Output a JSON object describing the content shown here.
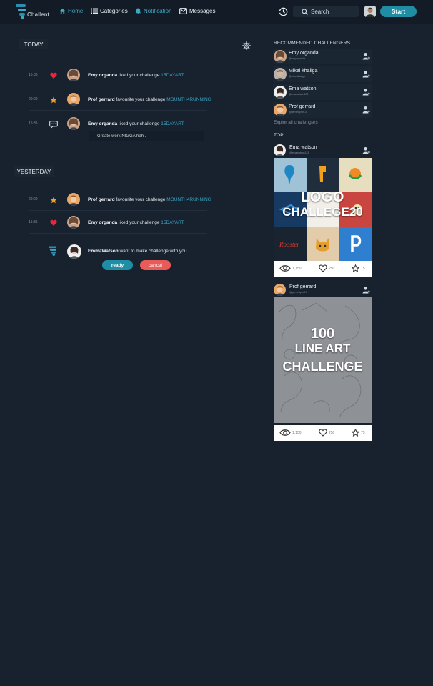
{
  "nav": {
    "brand": "Challent",
    "items": [
      {
        "label": "Home",
        "active": true
      },
      {
        "label": "Categories",
        "active": false
      },
      {
        "label": "Notification",
        "active": true
      },
      {
        "label": "Messages",
        "active": false
      }
    ],
    "search_placeholder": "Search",
    "start_label": "Start"
  },
  "colors": {
    "accent": "#1f8ea4",
    "danger": "#e85b58",
    "background": "#18222f",
    "heart": "#e8283a",
    "star": "#f0a21d"
  },
  "notifications": {
    "today_label": "TODAY",
    "yesterday_label": "YESTERDAY",
    "today": [
      {
        "time": "15:35",
        "icon": "heart-icon",
        "user": "Emy organda",
        "action": "liked your challenge",
        "tag": "15DAYART"
      },
      {
        "time": "20:00",
        "icon": "star-icon",
        "user": "Prof gerrard",
        "action": "favourite your challenge",
        "tag": "MOUNTH4RUNNING"
      },
      {
        "time": "15:35",
        "icon": "comment-icon",
        "user": "Emy organda",
        "action": "liked your challenge",
        "tag": "15DAYART"
      }
    ],
    "comment": "Greate work NIGGA hah .",
    "yesterday": [
      {
        "time": "20:00",
        "icon": "star-icon",
        "user": "Prof gerrard",
        "action": "favourite your challenge",
        "tag": "MOUNTH4RUNNING"
      },
      {
        "time": "15:35",
        "icon": "heart-icon",
        "user": "Emy organda",
        "action": "liked your challenge",
        "tag": "15DAYART"
      }
    ],
    "request": {
      "user": "EmmaWatson",
      "text": "want to make challenge with you",
      "ready_label": "ready",
      "cancel_label": "cancel"
    }
  },
  "sidebar": {
    "recommended_title": "RECOMMENDED CHALLENGERS",
    "recommended": [
      {
        "name": "Emy organda",
        "handle": "@emyorganda"
      },
      {
        "name": "Mikel khallga",
        "handle": "@mikelkhallga"
      },
      {
        "name": "Ema watson",
        "handle": "@emawatson123"
      },
      {
        "name": "Prof gerrard",
        "handle": "@gerrardprof13"
      }
    ],
    "explore_label": "Explor all challengers",
    "top_title": "TOP",
    "cards": [
      {
        "name": "Ema watson",
        "handle": "@emawatson123",
        "title_line1": "LOGO",
        "title_line2": "CHALLEGE20",
        "views": "1,150",
        "likes": "250",
        "stars": "75"
      },
      {
        "name": "Prof gerrard",
        "handle": "@gerrardprof13",
        "title_line1": "100",
        "title_line2": "LINE ART",
        "title_line3": "CHALLENGE",
        "views": "1,150",
        "likes": "250",
        "stars": "75"
      }
    ]
  }
}
